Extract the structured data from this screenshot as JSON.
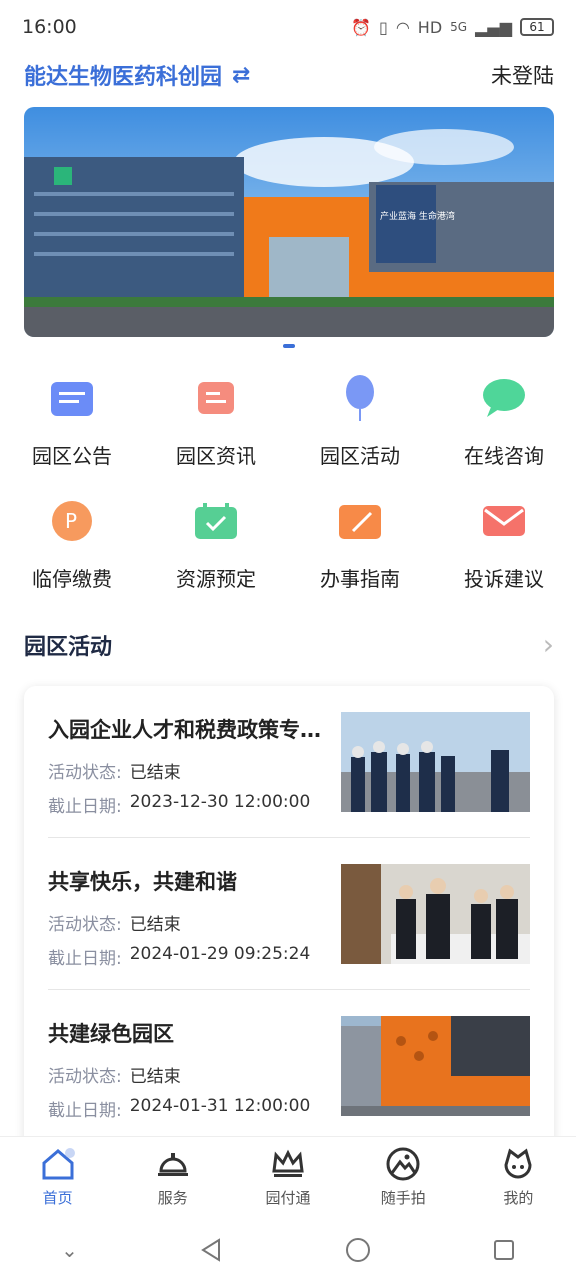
{
  "status": {
    "time": "16:00",
    "network": "HD",
    "signal": "5G",
    "battery": "61"
  },
  "header": {
    "park_name": "能达生物医药科创园",
    "login": "未登陆"
  },
  "banner": {
    "sign_text": "产业蓝海 生命港湾"
  },
  "grid": [
    {
      "label": "园区公告",
      "icon": "notice-icon",
      "color": "#5b7cf5"
    },
    {
      "label": "园区资讯",
      "icon": "news-icon",
      "color": "#f07a6a"
    },
    {
      "label": "园区活动",
      "icon": "balloon-icon",
      "color": "#6a8df5"
    },
    {
      "label": "在线咨询",
      "icon": "chat-icon",
      "color": "#3fcf8e"
    },
    {
      "label": "临停缴费",
      "icon": "parking-icon",
      "color": "#f58a4a"
    },
    {
      "label": "资源预定",
      "icon": "calendar-icon",
      "color": "#49c98a"
    },
    {
      "label": "办事指南",
      "icon": "guide-icon",
      "color": "#f5823f"
    },
    {
      "label": "投诉建议",
      "icon": "mail-icon",
      "color": "#f0625a"
    }
  ],
  "section": {
    "title": "园区活动"
  },
  "activities": [
    {
      "title": "入园企业人才和税费政策专…",
      "status_label": "活动状态:",
      "status": "已结束",
      "date_label": "截止日期:",
      "date": "2023-12-30 12:00:00"
    },
    {
      "title": "共享快乐，共建和谐",
      "status_label": "活动状态:",
      "status": "已结束",
      "date_label": "截止日期:",
      "date": "2024-01-29 09:25:24"
    },
    {
      "title": "共建绿色园区",
      "status_label": "活动状态:",
      "status": "已结束",
      "date_label": "截止日期:",
      "date": "2024-01-31 12:00:00"
    }
  ],
  "tabs": [
    {
      "label": "首页",
      "icon": "home-icon",
      "active": true
    },
    {
      "label": "服务",
      "icon": "service-bell-icon"
    },
    {
      "label": "园付通",
      "icon": "crown-icon"
    },
    {
      "label": "随手拍",
      "icon": "photo-icon"
    },
    {
      "label": "我的",
      "icon": "profile-icon"
    }
  ],
  "colors": {
    "accent": "#3b6fd8"
  }
}
